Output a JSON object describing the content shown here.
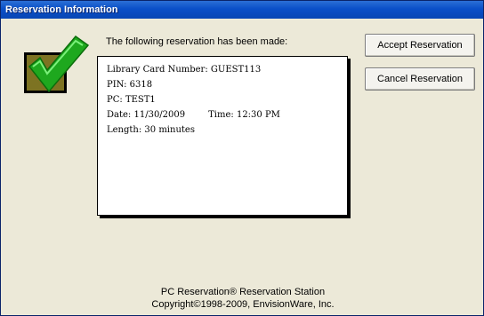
{
  "window": {
    "title": "Reservation Information"
  },
  "icons": {
    "confirmation": "check-mark-icon",
    "check_color": "#22cc22",
    "box_color": "#7d7322"
  },
  "main": {
    "prompt": "The following reservation has been made:",
    "details": {
      "card_number_label": "Library Card Number:",
      "card_number": "GUEST113",
      "pin_label": "PIN:",
      "pin": "6318",
      "pc_label": "PC:",
      "pc": "TEST1",
      "date_label": "Date:",
      "date": "11/30/2009",
      "time_label": "Time:",
      "time": "12:30 PM",
      "length_label": "Length:",
      "length": "30 minutes"
    }
  },
  "buttons": {
    "accept_label": "Accept Reservation",
    "cancel_label": "Cancel Reservation"
  },
  "footer": {
    "line1": "PC Reservation® Reservation Station",
    "line2": "Copyright©1998-2009, EnvisionWare, Inc."
  }
}
